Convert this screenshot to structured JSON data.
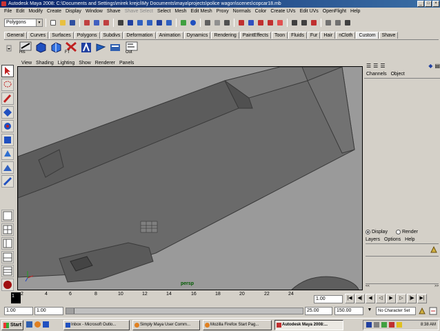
{
  "window": {
    "title": "Autodesk Maya 2008: C:\\Documents and Settings\\mirek krejci\\My Documents\\maya\\projects\\police wagon\\scenes\\copcar18.mb"
  },
  "menu": [
    "File",
    "Edit",
    "Modify",
    "Create",
    "Display",
    "Window",
    "Shave",
    "Select",
    "Mesh",
    "Edit Mesh",
    "Proxy",
    "Normals",
    "Color",
    "Create UVs",
    "Edit UVs",
    "OpenFlight",
    "Help"
  ],
  "menu_disabled": "Shave Select",
  "status_line": {
    "mode": "Polygons"
  },
  "shelf_tabs": [
    "General",
    "Curves",
    "Surfaces",
    "Polygons",
    "Subdivs",
    "Deformation",
    "Animation",
    "Dynamics",
    "Rendering",
    "PaintEffects",
    "Toon",
    "Fluids",
    "Fur",
    "Hair",
    "nCloth",
    "Custom",
    "Shave"
  ],
  "shelf_active_tab": "Custom",
  "shelf_labels": {
    "his": "His",
    "ft": "FT",
    "out": "Out"
  },
  "panel_menu": [
    "View",
    "Shading",
    "Lighting",
    "Show",
    "Renderer",
    "Panels"
  ],
  "viewport": {
    "camera_label": "persp",
    "bg_color": "#9a9a9a",
    "mesh_color": "#6a6a6a"
  },
  "channel_box": {
    "menu": [
      "Channels",
      "Object"
    ]
  },
  "layer_editor": {
    "modes": [
      "Display",
      "Render"
    ],
    "selected_mode": "Display",
    "menu": [
      "Layers",
      "Options",
      "Help"
    ]
  },
  "time_slider": {
    "ticks": [
      "2",
      "4",
      "6",
      "8",
      "10",
      "12",
      "14",
      "16",
      "18",
      "20",
      "22",
      "24"
    ],
    "current_frame": "1",
    "current_frame_field": "1.00"
  },
  "range_slider": {
    "start": "1.00",
    "playback_start": "1.00",
    "playback_end": "25.00",
    "end": "150.00",
    "character_set": "No Character Set"
  },
  "taskbar": {
    "start_label": "Start",
    "tasks": [
      "Inbox - Microsoft Outlo...",
      "Simply Maya User Comm...",
      "Mozilla Firefox Start Pag...",
      "Autodesk Maya 2008:..."
    ],
    "active_task": "Autodesk Maya 2008:...",
    "clock": "8:38 AM"
  }
}
